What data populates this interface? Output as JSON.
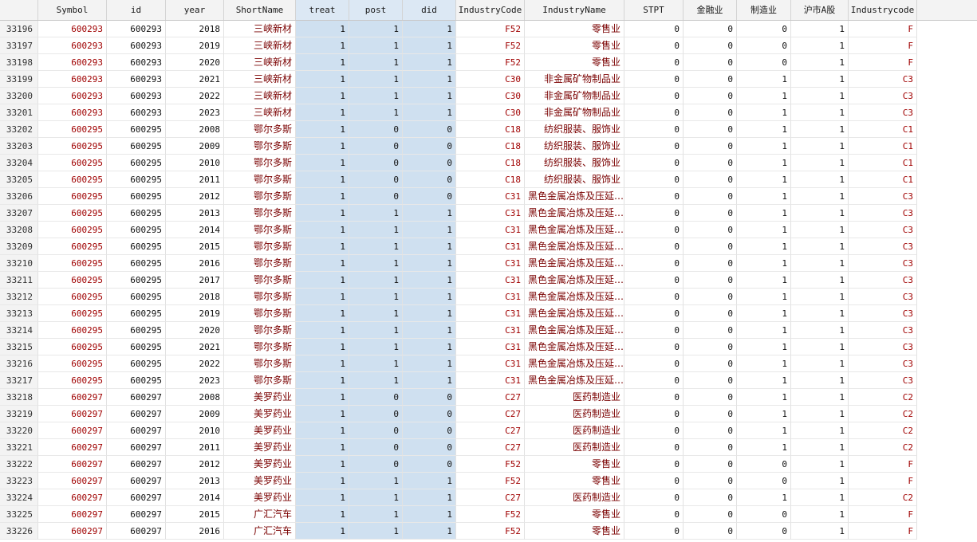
{
  "columns": [
    "",
    "Symbol",
    "id",
    "year",
    "ShortName",
    "treat",
    "post",
    "did",
    "IndustryCode",
    "IndustryName",
    "STPT",
    "金融业",
    "制造业",
    "沪市A股",
    "Industrycode"
  ],
  "rows": [
    [
      "33196",
      "600293",
      "600293",
      "2018",
      "三峡新材",
      "1",
      "1",
      "1",
      "F52",
      "零售业",
      "0",
      "0",
      "0",
      "1",
      "F"
    ],
    [
      "33197",
      "600293",
      "600293",
      "2019",
      "三峡新材",
      "1",
      "1",
      "1",
      "F52",
      "零售业",
      "0",
      "0",
      "0",
      "1",
      "F"
    ],
    [
      "33198",
      "600293",
      "600293",
      "2020",
      "三峡新材",
      "1",
      "1",
      "1",
      "F52",
      "零售业",
      "0",
      "0",
      "0",
      "1",
      "F"
    ],
    [
      "33199",
      "600293",
      "600293",
      "2021",
      "三峡新材",
      "1",
      "1",
      "1",
      "C30",
      "非金属矿物制品业",
      "0",
      "0",
      "1",
      "1",
      "C3"
    ],
    [
      "33200",
      "600293",
      "600293",
      "2022",
      "三峡新材",
      "1",
      "1",
      "1",
      "C30",
      "非金属矿物制品业",
      "0",
      "0",
      "1",
      "1",
      "C3"
    ],
    [
      "33201",
      "600293",
      "600293",
      "2023",
      "三峡新材",
      "1",
      "1",
      "1",
      "C30",
      "非金属矿物制品业",
      "0",
      "0",
      "1",
      "1",
      "C3"
    ],
    [
      "33202",
      "600295",
      "600295",
      "2008",
      "鄂尔多斯",
      "1",
      "0",
      "0",
      "C18",
      "纺织服装、服饰业",
      "0",
      "0",
      "1",
      "1",
      "C1"
    ],
    [
      "33203",
      "600295",
      "600295",
      "2009",
      "鄂尔多斯",
      "1",
      "0",
      "0",
      "C18",
      "纺织服装、服饰业",
      "0",
      "0",
      "1",
      "1",
      "C1"
    ],
    [
      "33204",
      "600295",
      "600295",
      "2010",
      "鄂尔多斯",
      "1",
      "0",
      "0",
      "C18",
      "纺织服装、服饰业",
      "0",
      "0",
      "1",
      "1",
      "C1"
    ],
    [
      "33205",
      "600295",
      "600295",
      "2011",
      "鄂尔多斯",
      "1",
      "0",
      "0",
      "C18",
      "纺织服装、服饰业",
      "0",
      "0",
      "1",
      "1",
      "C1"
    ],
    [
      "33206",
      "600295",
      "600295",
      "2012",
      "鄂尔多斯",
      "1",
      "0",
      "0",
      "C31",
      "黑色金属冶炼及压延…",
      "0",
      "0",
      "1",
      "1",
      "C3"
    ],
    [
      "33207",
      "600295",
      "600295",
      "2013",
      "鄂尔多斯",
      "1",
      "1",
      "1",
      "C31",
      "黑色金属冶炼及压延…",
      "0",
      "0",
      "1",
      "1",
      "C3"
    ],
    [
      "33208",
      "600295",
      "600295",
      "2014",
      "鄂尔多斯",
      "1",
      "1",
      "1",
      "C31",
      "黑色金属冶炼及压延…",
      "0",
      "0",
      "1",
      "1",
      "C3"
    ],
    [
      "33209",
      "600295",
      "600295",
      "2015",
      "鄂尔多斯",
      "1",
      "1",
      "1",
      "C31",
      "黑色金属冶炼及压延…",
      "0",
      "0",
      "1",
      "1",
      "C3"
    ],
    [
      "33210",
      "600295",
      "600295",
      "2016",
      "鄂尔多斯",
      "1",
      "1",
      "1",
      "C31",
      "黑色金属冶炼及压延…",
      "0",
      "0",
      "1",
      "1",
      "C3"
    ],
    [
      "33211",
      "600295",
      "600295",
      "2017",
      "鄂尔多斯",
      "1",
      "1",
      "1",
      "C31",
      "黑色金属冶炼及压延…",
      "0",
      "0",
      "1",
      "1",
      "C3"
    ],
    [
      "33212",
      "600295",
      "600295",
      "2018",
      "鄂尔多斯",
      "1",
      "1",
      "1",
      "C31",
      "黑色金属冶炼及压延…",
      "0",
      "0",
      "1",
      "1",
      "C3"
    ],
    [
      "33213",
      "600295",
      "600295",
      "2019",
      "鄂尔多斯",
      "1",
      "1",
      "1",
      "C31",
      "黑色金属冶炼及压延…",
      "0",
      "0",
      "1",
      "1",
      "C3"
    ],
    [
      "33214",
      "600295",
      "600295",
      "2020",
      "鄂尔多斯",
      "1",
      "1",
      "1",
      "C31",
      "黑色金属冶炼及压延…",
      "0",
      "0",
      "1",
      "1",
      "C3"
    ],
    [
      "33215",
      "600295",
      "600295",
      "2021",
      "鄂尔多斯",
      "1",
      "1",
      "1",
      "C31",
      "黑色金属冶炼及压延…",
      "0",
      "0",
      "1",
      "1",
      "C3"
    ],
    [
      "33216",
      "600295",
      "600295",
      "2022",
      "鄂尔多斯",
      "1",
      "1",
      "1",
      "C31",
      "黑色金属冶炼及压延…",
      "0",
      "0",
      "1",
      "1",
      "C3"
    ],
    [
      "33217",
      "600295",
      "600295",
      "2023",
      "鄂尔多斯",
      "1",
      "1",
      "1",
      "C31",
      "黑色金属冶炼及压延…",
      "0",
      "0",
      "1",
      "1",
      "C3"
    ],
    [
      "33218",
      "600297",
      "600297",
      "2008",
      "美罗药业",
      "1",
      "0",
      "0",
      "C27",
      "医药制造业",
      "0",
      "0",
      "1",
      "1",
      "C2"
    ],
    [
      "33219",
      "600297",
      "600297",
      "2009",
      "美罗药业",
      "1",
      "0",
      "0",
      "C27",
      "医药制造业",
      "0",
      "0",
      "1",
      "1",
      "C2"
    ],
    [
      "33220",
      "600297",
      "600297",
      "2010",
      "美罗药业",
      "1",
      "0",
      "0",
      "C27",
      "医药制造业",
      "0",
      "0",
      "1",
      "1",
      "C2"
    ],
    [
      "33221",
      "600297",
      "600297",
      "2011",
      "美罗药业",
      "1",
      "0",
      "0",
      "C27",
      "医药制造业",
      "0",
      "0",
      "1",
      "1",
      "C2"
    ],
    [
      "33222",
      "600297",
      "600297",
      "2012",
      "美罗药业",
      "1",
      "0",
      "0",
      "F52",
      "零售业",
      "0",
      "0",
      "0",
      "1",
      "F"
    ],
    [
      "33223",
      "600297",
      "600297",
      "2013",
      "美罗药业",
      "1",
      "1",
      "1",
      "F52",
      "零售业",
      "0",
      "0",
      "0",
      "1",
      "F"
    ],
    [
      "33224",
      "600297",
      "600297",
      "2014",
      "美罗药业",
      "1",
      "1",
      "1",
      "C27",
      "医药制造业",
      "0",
      "0",
      "1",
      "1",
      "C2"
    ],
    [
      "33225",
      "600297",
      "600297",
      "2015",
      "广汇汽车",
      "1",
      "1",
      "1",
      "F52",
      "零售业",
      "0",
      "0",
      "0",
      "1",
      "F"
    ],
    [
      "33226",
      "600297",
      "600297",
      "2016",
      "广汇汽车",
      "1",
      "1",
      "1",
      "F52",
      "零售业",
      "0",
      "0",
      "0",
      "1",
      "F"
    ]
  ]
}
